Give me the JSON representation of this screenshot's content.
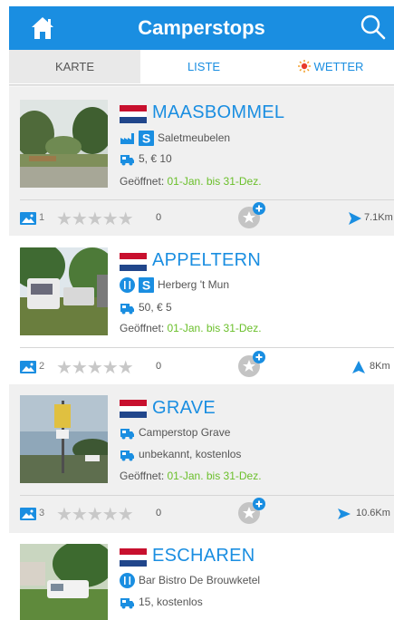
{
  "app": {
    "title": "Camperstops",
    "home_icon": "home-icon",
    "search_icon": "search-icon",
    "accent": "#1a8ee1"
  },
  "tabs": [
    {
      "label": "KARTE",
      "active": false
    },
    {
      "label": "LISTE",
      "active": true
    },
    {
      "label": "WETTER",
      "icon": "sun-icon",
      "active": false
    }
  ],
  "colors": {
    "flag_red": "#c8102e",
    "flag_white": "#ffffff",
    "flag_blue": "#21468b",
    "open_date": "#6abf2a",
    "star_empty": "#c8c8c8"
  },
  "stops": [
    {
      "name": "MAASBOMMEL",
      "flag": "netherlands-flag-icon",
      "place": "Saletmeubelen",
      "place_icons": [
        "factory-icon",
        "s-badge-icon"
      ],
      "spots": "5, € 10",
      "open_label": "Geöffnet:",
      "open_dates": "01-Jan. bis 31-Dez.",
      "photos": "1",
      "rating": "0",
      "distance": "7.1Km"
    },
    {
      "name": "APPELTERN",
      "flag": "netherlands-flag-icon",
      "place": "Herberg 't Mun",
      "place_icons": [
        "restaurant-icon",
        "s-badge-icon"
      ],
      "spots": "50, € 5",
      "open_label": "Geöffnet:",
      "open_dates": "01-Jan. bis 31-Dez.",
      "photos": "2",
      "rating": "0",
      "distance": "8Km"
    },
    {
      "name": "GRAVE",
      "flag": "netherlands-flag-icon",
      "place": "Camperstop Grave",
      "place_icons": [
        "camper-icon"
      ],
      "spots": "unbekannt, kostenlos",
      "open_label": "Geöffnet:",
      "open_dates": "01-Jan. bis 31-Dez.",
      "photos": "3",
      "rating": "0",
      "distance": "10.6Km"
    },
    {
      "name": "ESCHAREN",
      "flag": "netherlands-flag-icon",
      "place": "Bar Bistro De Brouwketel",
      "place_icons": [
        "restaurant-icon"
      ],
      "spots": "15, kostenlos"
    }
  ],
  "stars_glyph": "★★★★★"
}
